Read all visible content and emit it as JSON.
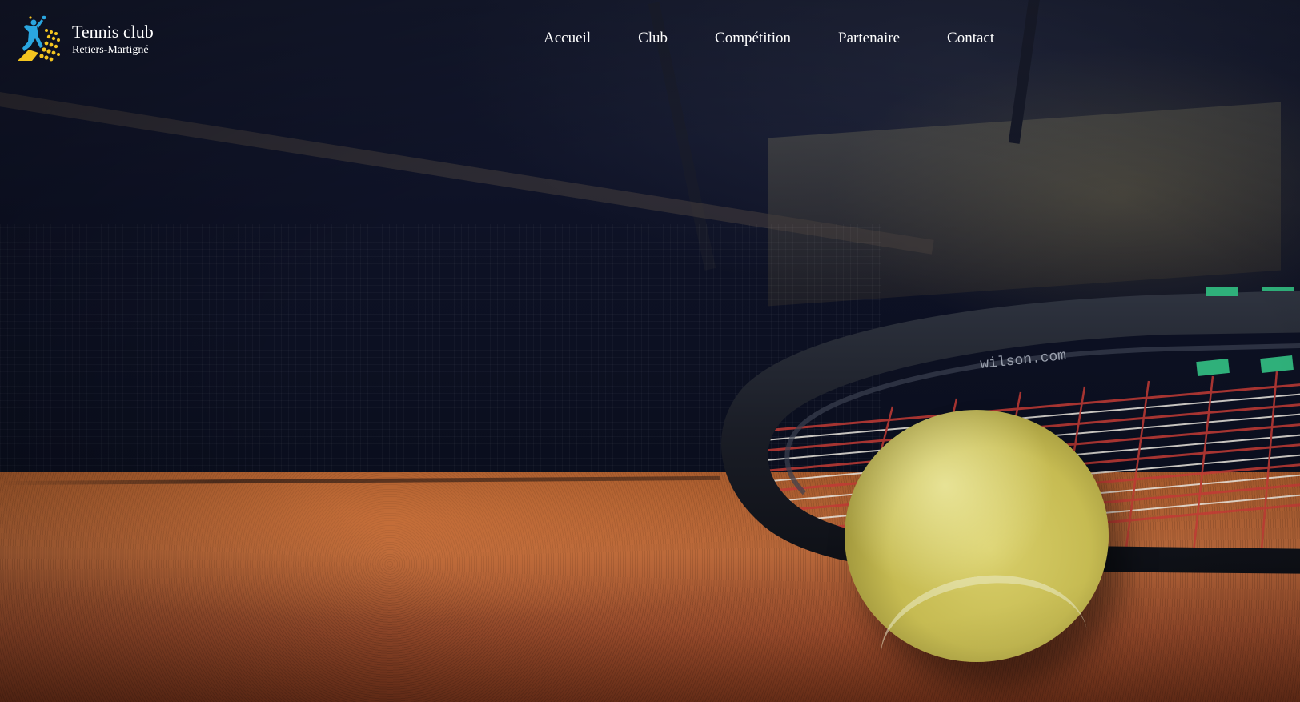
{
  "brand": {
    "title": "Tennis club",
    "subtitle": "Retiers-Martigné",
    "logo_icon": "tennis-player-logo-icon"
  },
  "nav": {
    "items": [
      {
        "label": "Accueil"
      },
      {
        "label": "Club"
      },
      {
        "label": "Compétition"
      },
      {
        "label": "Partenaire"
      },
      {
        "label": "Contact"
      }
    ]
  },
  "hero": {
    "image_subject": "tennis racket and ball on clay court",
    "racket_text": "wilson.com"
  },
  "colors": {
    "nav_text": "#ffffff",
    "logo_blue": "#2aa6e0",
    "logo_yellow": "#f4c520",
    "court": "#b5663a",
    "ball": "#d9cf6a"
  }
}
